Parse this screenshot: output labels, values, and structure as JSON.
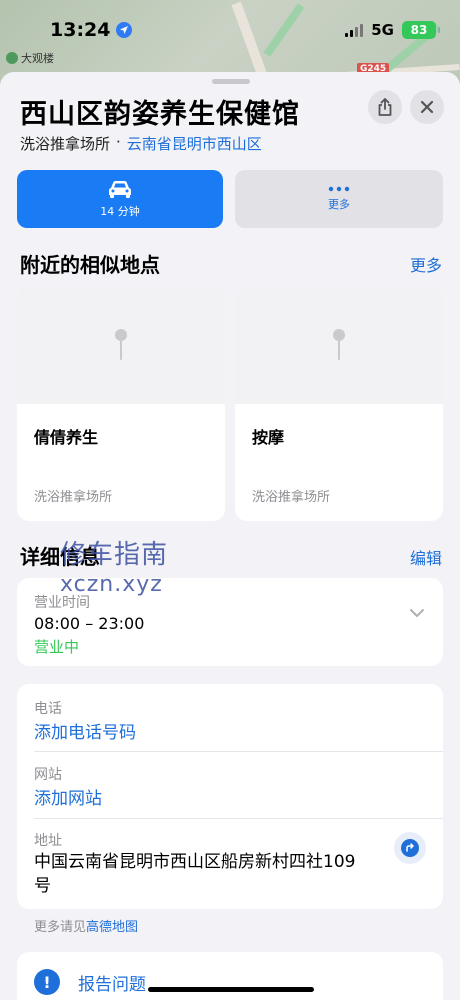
{
  "status_bar": {
    "time": "13:24",
    "network": "5G",
    "battery": "83"
  },
  "map": {
    "poi_label": "大观楼",
    "road_label": "G245"
  },
  "place": {
    "title": "西山区韵姿养生保健馆",
    "category": "洗浴推拿场所",
    "separator": "·",
    "location": "云南省昆明市西山区"
  },
  "actions": {
    "drive_label": "14 分钟",
    "more_label": "更多"
  },
  "nearby": {
    "heading": "附近的相似地点",
    "more_link": "更多",
    "items": [
      {
        "name": "倩倩养生",
        "category": "洗浴推拿场所"
      },
      {
        "name": "按摩",
        "category": "洗浴推拿场所"
      }
    ]
  },
  "details": {
    "heading": "详细信息",
    "edit_link": "编辑",
    "hours_label": "营业时间",
    "hours_value": "08:00 – 23:00",
    "open_status": "营业中",
    "phone_label": "电话",
    "phone_action": "添加电话号码",
    "website_label": "网站",
    "website_action": "添加网站",
    "address_label": "地址",
    "address_value": "中国云南省昆明市西山区船房新村四社109号"
  },
  "more_info": {
    "prefix": "更多请见",
    "link": "高德地图"
  },
  "report": {
    "label": "报告问题"
  },
  "watermark": {
    "line1": "修车指南",
    "line2": "xczn.xyz"
  }
}
